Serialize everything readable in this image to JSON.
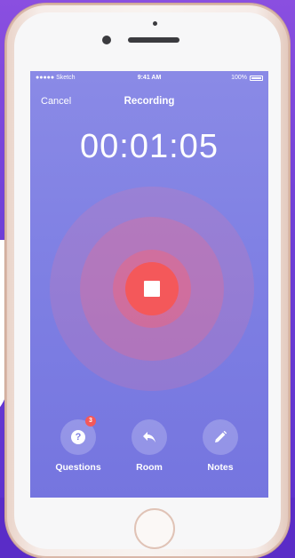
{
  "status_bar": {
    "carrier": "●●●●● Sketch",
    "time": "9:41 AM",
    "battery": "100%"
  },
  "nav": {
    "cancel_label": "Cancel",
    "title": "Recording"
  },
  "timer": {
    "value": "00:01:05"
  },
  "record_button": {
    "icon": "stop-icon",
    "color": "#f4585a"
  },
  "actions": [
    {
      "label": "Questions",
      "icon": "question-icon",
      "badge": "3"
    },
    {
      "label": "Room",
      "icon": "reply-arrow-icon"
    },
    {
      "label": "Notes",
      "icon": "pencil-icon"
    }
  ],
  "colors": {
    "screen_bg": "#7e7fe3",
    "accent_red": "#f4585a",
    "background_purple": "#6d3ed6"
  }
}
